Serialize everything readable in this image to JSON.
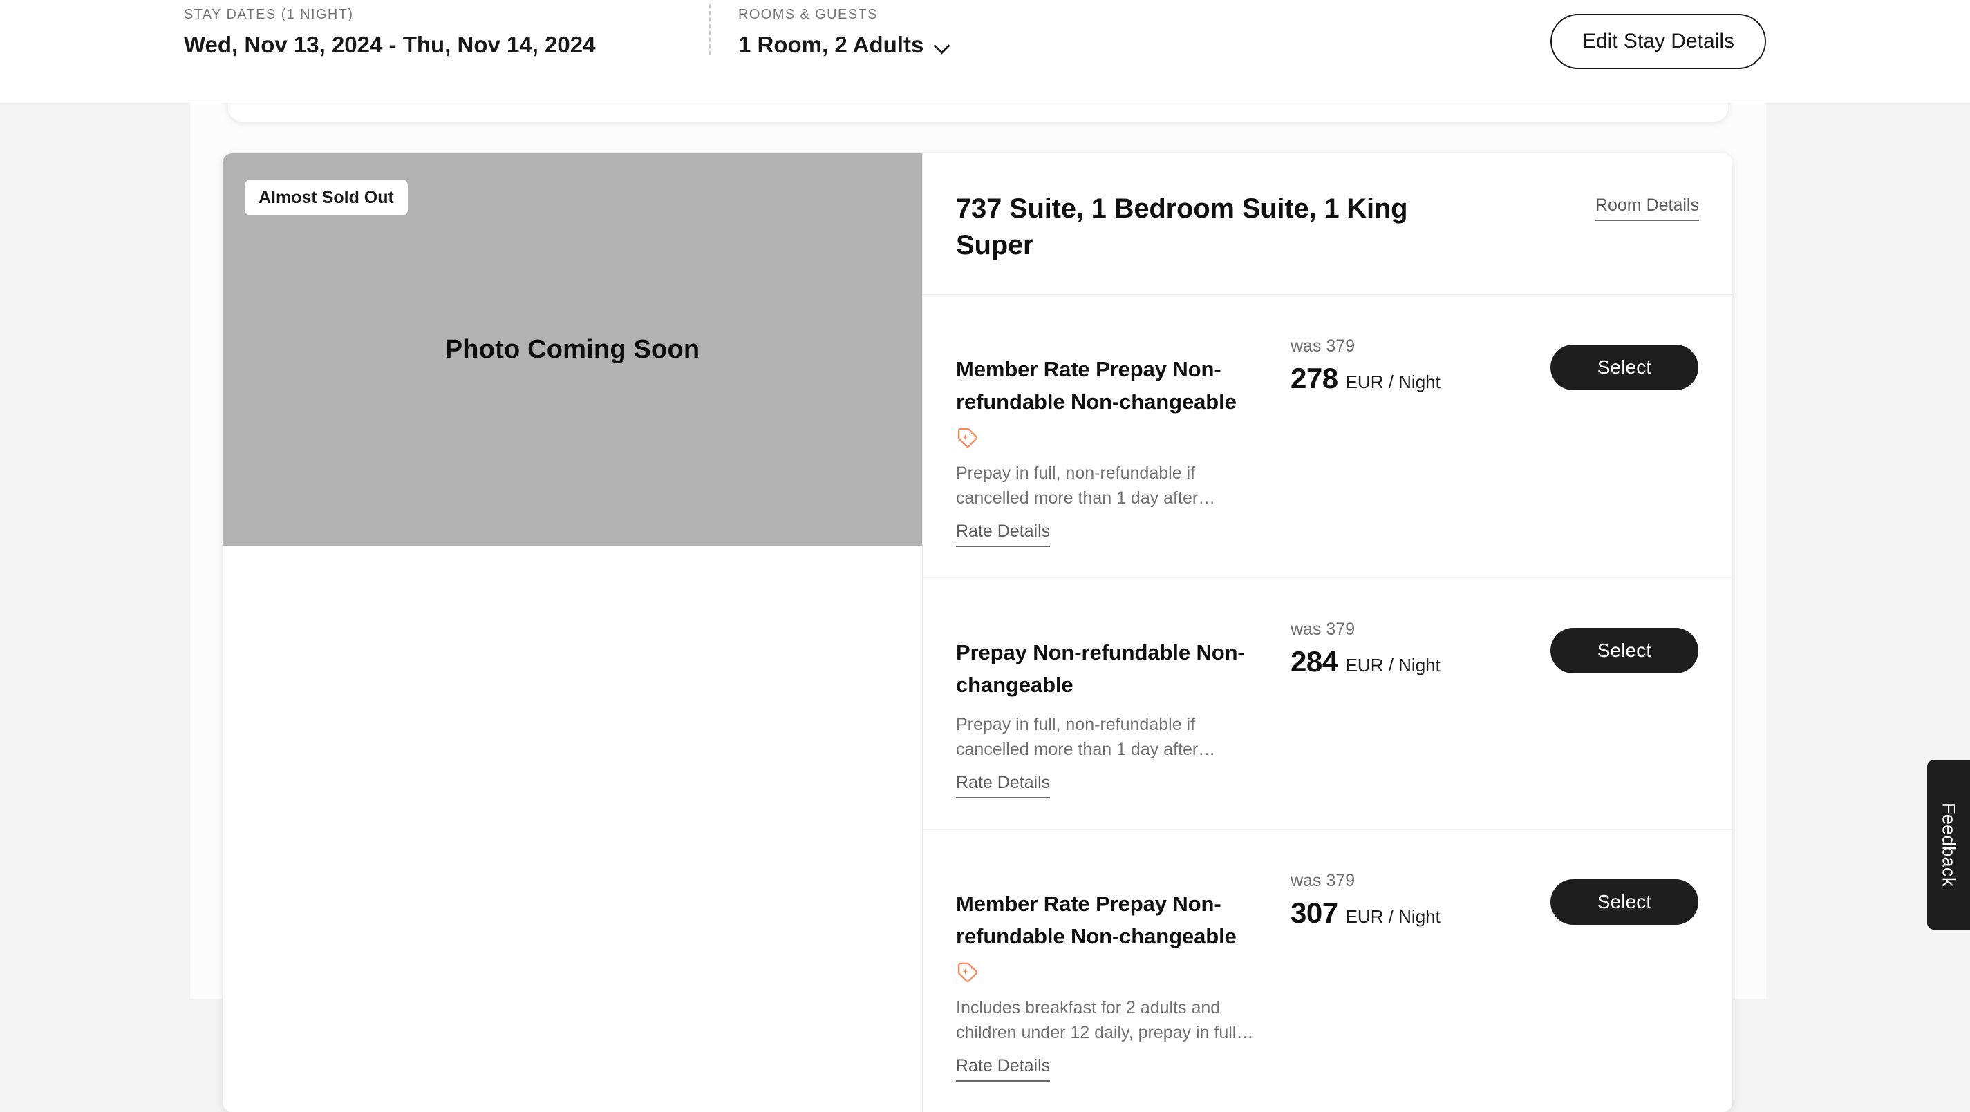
{
  "header": {
    "stay_dates_label": "STAY DATES (1 NIGHT)",
    "stay_dates_value": "Wed, Nov 13, 2024 - Thu, Nov 14, 2024",
    "rooms_guests_label": "ROOMS & GUESTS",
    "rooms_guests_value": "1 Room, 2 Adults",
    "edit_button": "Edit Stay Details"
  },
  "room": {
    "badge": "Almost Sold Out",
    "photo_placeholder": "Photo Coming Soon",
    "title": "737 Suite, 1 Bedroom Suite, 1 King Super",
    "room_details_link": "Room Details"
  },
  "rates": [
    {
      "name": "Member Rate Prepay Non-refundable Non-changeable",
      "has_member_tag": true,
      "description": "Prepay in full, non-refundable if cancelled more than 1 day after…",
      "details_link": "Rate Details",
      "was_price": "was 379",
      "price": "278",
      "unit": "EUR / Night",
      "select_label": "Select"
    },
    {
      "name": "Prepay Non-refundable Non-changeable",
      "has_member_tag": false,
      "description": "Prepay in full, non-refundable if cancelled more than 1 day after…",
      "details_link": "Rate Details",
      "was_price": "was 379",
      "price": "284",
      "unit": "EUR / Night",
      "select_label": "Select"
    },
    {
      "name": "Member Rate Prepay Non-refundable Non-changeable",
      "has_member_tag": true,
      "description": "Includes breakfast for 2 adults and children under 12 daily, prepay in full…",
      "details_link": "Rate Details",
      "was_price": "was 379",
      "price": "307",
      "unit": "EUR / Night",
      "select_label": "Select"
    }
  ],
  "feedback": {
    "label": "Feedback"
  },
  "icons": {
    "chevron": "chevron-down-icon",
    "member_tag": "member-rate-tag-icon"
  },
  "colors": {
    "page_background": "#f3f3f3",
    "card_background": "#ffffff",
    "accent_dark": "#1e1e1e",
    "member_tag_orange": "#f78c5e",
    "photo_placeholder_gray": "#b2b2b2",
    "muted_text": "#707070"
  }
}
